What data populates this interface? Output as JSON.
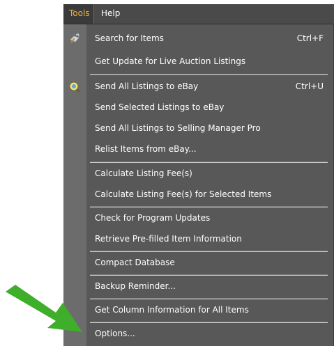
{
  "menubar": {
    "tools_label": "Tools",
    "help_label": "Help"
  },
  "menu": {
    "items": [
      {
        "label": "Search for Items",
        "shortcut": "Ctrl+F",
        "icon": "search-items-icon"
      },
      {
        "label": "Get Update for Live Auction Listings"
      },
      {
        "label": "Send All Listings to eBay",
        "shortcut": "Ctrl+U",
        "icon": "send-ebay-icon"
      },
      {
        "label": "Send Selected Listings to eBay"
      },
      {
        "label": "Send All Listings to Selling Manager Pro"
      },
      {
        "label": "Relist Items from eBay..."
      },
      {
        "label": "Calculate Listing Fee(s)"
      },
      {
        "label": "Calculate Listing Fee(s) for Selected Items"
      },
      {
        "label": "Check for Program Updates"
      },
      {
        "label": "Retrieve Pre-filled Item Information"
      },
      {
        "label": "Compact Database"
      },
      {
        "label": "Backup Reminder..."
      },
      {
        "label": "Get Column Information for All Items"
      },
      {
        "label": "Options..."
      }
    ]
  },
  "annotation": {
    "arrow_color": "#3fae2a"
  }
}
